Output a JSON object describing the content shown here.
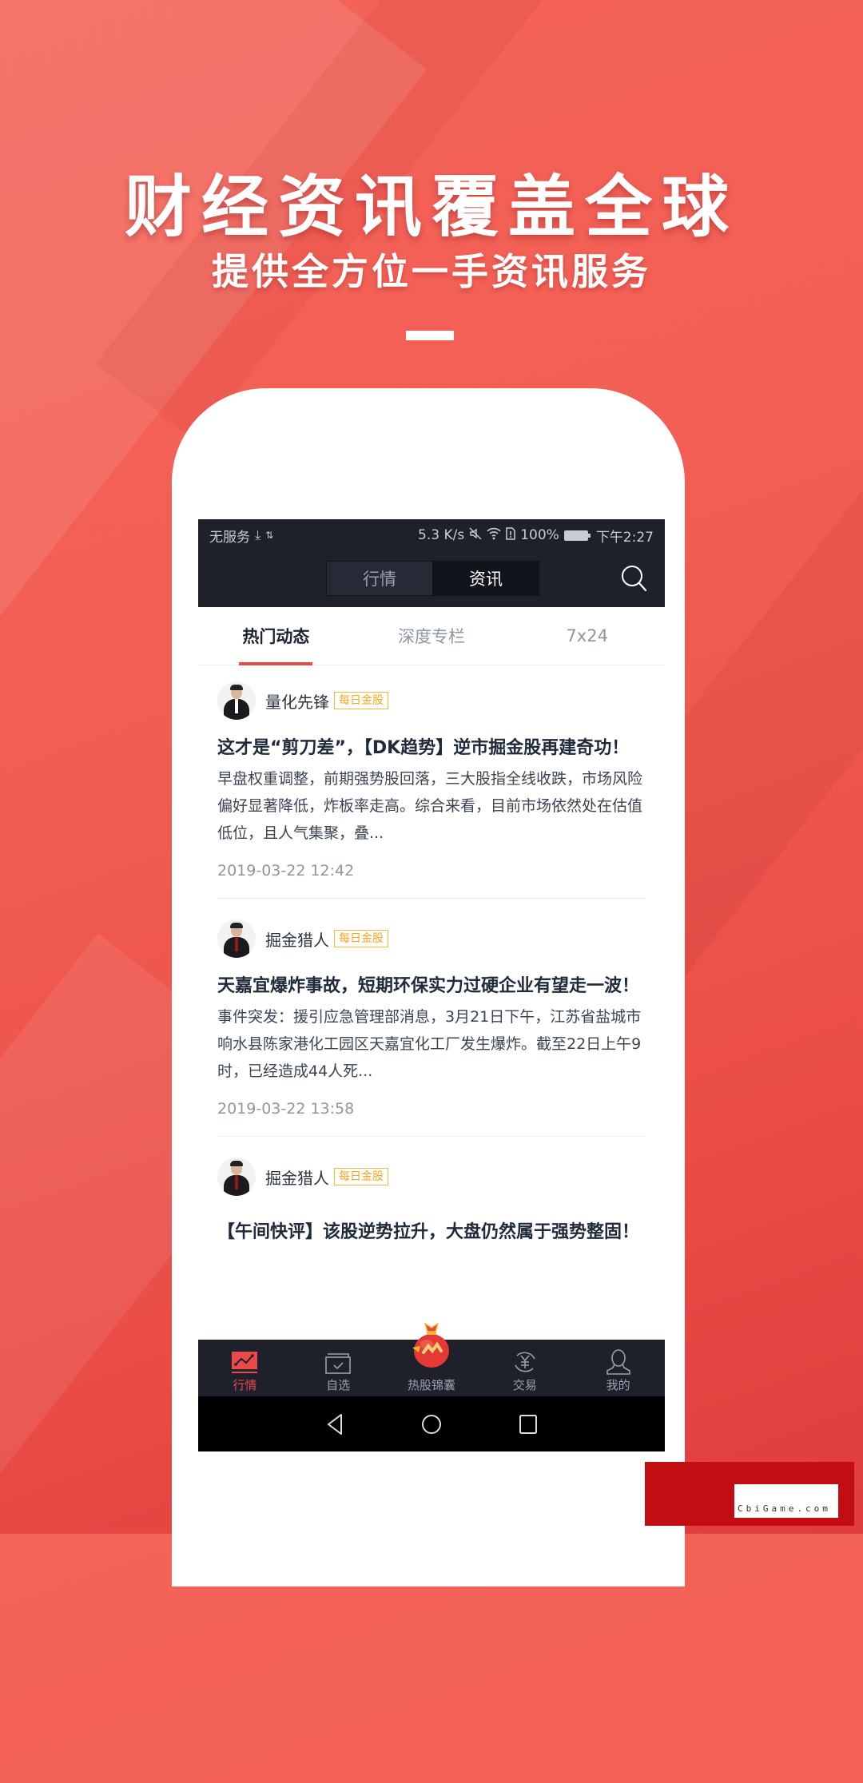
{
  "promo": {
    "headline": "财经资讯覆盖全球",
    "subheadline": "提供全方位一手资讯服务"
  },
  "statusbar": {
    "carrier": "无服务",
    "speed": "5.3 K/s",
    "battery": "100%",
    "time": "下午2:27"
  },
  "topnav": {
    "segments": [
      {
        "label": "行情",
        "active": false
      },
      {
        "label": "资讯",
        "active": true
      }
    ],
    "search_icon": "search-icon"
  },
  "subtabs": [
    {
      "label": "热门动态",
      "active": true
    },
    {
      "label": "深度专栏",
      "active": false
    },
    {
      "label": "7x24",
      "active": false
    }
  ],
  "articles": [
    {
      "author": "量化先锋",
      "tag": "每日金股",
      "title": "这才是“剪刀差”，【DK趋势】逆市掘金股再建奇功！",
      "summary": "早盘权重调整，前期强势股回落，三大股指全线收跌，市场风险偏好显著降低，炸板率走高。综合来看，目前市场依然处在估值低位，且人气集聚，叠...",
      "time": "2019-03-22 12:42"
    },
    {
      "author": "掘金猎人",
      "tag": "每日金股",
      "title": "天嘉宜爆炸事故，短期环保实力过硬企业有望走一波！",
      "summary": "事件突发：援引应急管理部消息，3月21日下午，江苏省盐城市响水县陈家港化工园区天嘉宜化工厂发生爆炸。截至22日上午9时，已经造成44人死...",
      "time": "2019-03-22 13:58"
    },
    {
      "author": "掘金猎人",
      "tag": "每日金股",
      "title": "【午间快评】该股逆势拉升，大盘仍然属于强势整固！",
      "summary": "",
      "time": ""
    }
  ],
  "bottomnav": [
    {
      "label": "行情",
      "icon": "chart-line-icon",
      "active": true
    },
    {
      "label": "自选",
      "icon": "watchlist-check-icon",
      "active": false
    },
    {
      "label": "热股锦囊",
      "icon": "lucky-bag-icon",
      "active": false
    },
    {
      "label": "交易",
      "icon": "yuan-exchange-icon",
      "active": false
    },
    {
      "label": "我的",
      "icon": "user-icon",
      "active": false
    }
  ],
  "watermark": {
    "text": "CbiGame.com"
  },
  "colors": {
    "accent": "#e84a4a",
    "tag": "#f5a623",
    "dark_bar": "#1e212c",
    "background": "#f25e54"
  }
}
